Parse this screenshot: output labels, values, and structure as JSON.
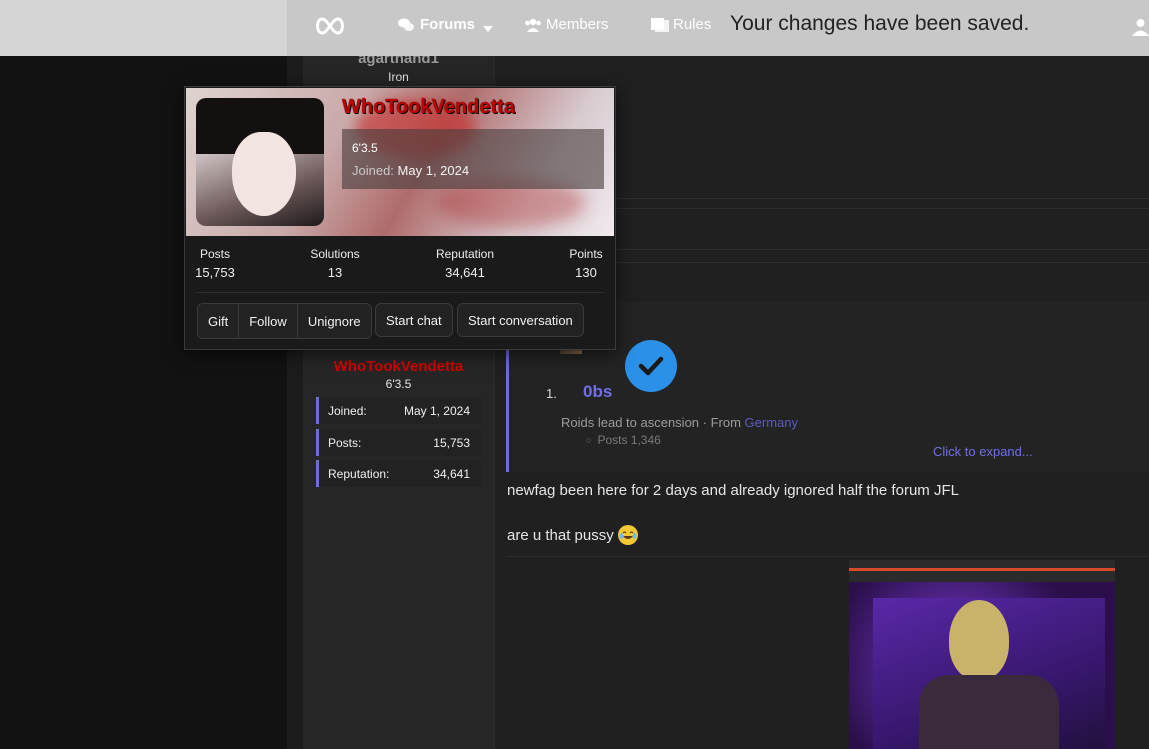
{
  "toast": {
    "message": "Your changes have been saved."
  },
  "nav": {
    "items": [
      {
        "label": "Forums",
        "icon": "comments-icon"
      },
      {
        "label": "Members",
        "icon": "users-icon"
      },
      {
        "label": "Rules",
        "icon": "book-icon"
      }
    ]
  },
  "sidebar_top": {
    "username": "agarthand1",
    "rank": "Iron"
  },
  "popup": {
    "username": "WhoTookVendetta",
    "height": "6'3.5",
    "joined_label": "Joined:",
    "joined_value": "May 1, 2024",
    "stats": [
      {
        "label": "Posts",
        "value": "15,753"
      },
      {
        "label": "Solutions",
        "value": "13"
      },
      {
        "label": "Reputation",
        "value": "34,641"
      },
      {
        "label": "Points",
        "value": "130"
      }
    ],
    "buttons": {
      "gift": "Gift",
      "follow": "Follow",
      "unignore": "Unignore",
      "start_chat": "Start chat",
      "start_conversation": "Start conversation"
    }
  },
  "user_sidebar": {
    "username": "WhoTookVendetta",
    "height": "6'3.5",
    "rows": [
      {
        "label": "Joined:",
        "value": "May 1, 2024"
      },
      {
        "label": "Posts:",
        "value": "15,753"
      },
      {
        "label": "Reputation:",
        "value": "34,641"
      }
    ]
  },
  "quote": {
    "list_number": "1.",
    "name": "0bs",
    "tagline": "Roids lead to ascension · From",
    "location": "Germany",
    "posts": "Posts 1,346",
    "expand": "Click to expand..."
  },
  "post": {
    "line1": "newfag been here for 2 days and already ignored half the forum JFL",
    "line2": "are u that pussy"
  },
  "colors": {
    "accent": "#6c6cdc",
    "username_red": "#d40000",
    "verified_blue": "#2b90e8"
  }
}
